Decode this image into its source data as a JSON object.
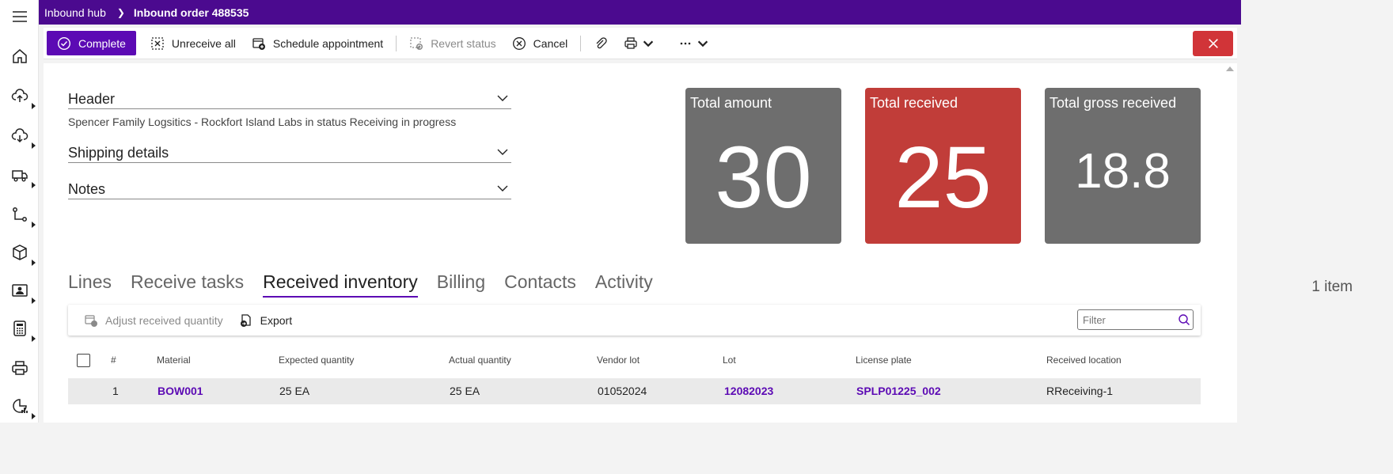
{
  "breadcrumb": {
    "parent": "Inbound hub",
    "current": "Inbound order 488535"
  },
  "toolbar": {
    "complete": "Complete",
    "unreceive_all": "Unreceive all",
    "schedule_appointment": "Schedule appointment",
    "revert_status": "Revert status",
    "cancel": "Cancel"
  },
  "sections": {
    "header": "Header",
    "header_summary": "Spencer Family Logsitics - Rockfort Island Labs in status Receiving in progress",
    "shipping": "Shipping details",
    "notes": "Notes"
  },
  "tiles": [
    {
      "label": "Total amount",
      "value": "30",
      "color": "#6e6e6e"
    },
    {
      "label": "Total received",
      "value": "25",
      "color": "#c13d39"
    },
    {
      "label": "Total gross received",
      "value": "18.8",
      "color": "#6e6e6e"
    }
  ],
  "tabs": [
    "Lines",
    "Receive tasks",
    "Received inventory",
    "Billing",
    "Contacts",
    "Activity"
  ],
  "active_tab": "Received inventory",
  "item_count": "1 item",
  "subtoolbar": {
    "adjust": "Adjust received quantity",
    "export": "Export"
  },
  "filter_placeholder": "Filter",
  "table": {
    "columns": [
      "#",
      "Material",
      "Expected quantity",
      "Actual quantity",
      "Vendor lot",
      "Lot",
      "License plate",
      "Received location"
    ],
    "rows": [
      {
        "num": "1",
        "material": "BOW001",
        "expected": "25 EA",
        "actual": "25 EA",
        "vendor_lot": "01052024",
        "lot": "12082023",
        "license_plate": "SPLP01225_002",
        "location": "RReceiving-1"
      }
    ]
  },
  "colors": {
    "brand": "#4b0a8f",
    "accent": "#5c0ab4",
    "danger": "#d13438"
  }
}
